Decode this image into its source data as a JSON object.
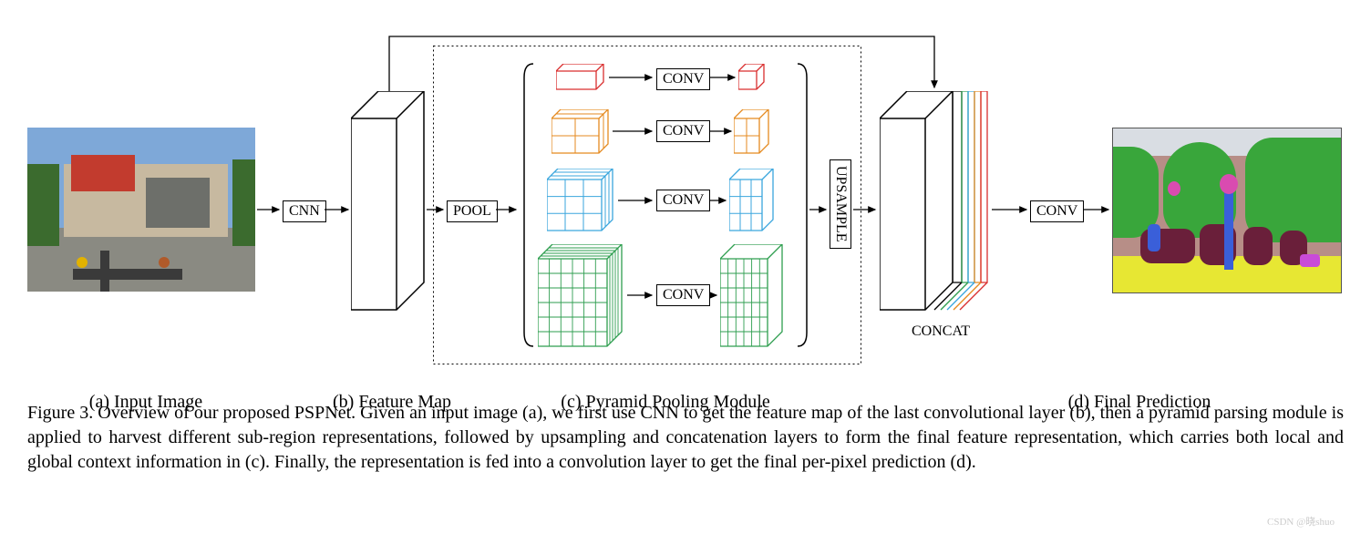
{
  "ops": {
    "cnn": "CNN",
    "pool": "POOL",
    "conv1": "CONV",
    "conv2": "CONV",
    "conv3": "CONV",
    "conv4": "CONV",
    "upsample": "UPSAMPLE",
    "conv_out": "CONV",
    "concat": "CONCAT"
  },
  "sublabels": {
    "a": "(a) Input Image",
    "b": "(b) Feature Map",
    "c": "(c) Pyramid Pooling Module",
    "d": "(d) Final Prediction"
  },
  "caption": "Figure 3. Overview of our proposed PSPNet. Given an input image (a), we first use CNN to get the feature map of the last convolutional layer (b), then a pyramid parsing module is applied to harvest different sub-region representations, followed by upsampling and concatenation layers to form the final feature representation, which carries both local and global context information in (c). Finally, the representation is fed into a convolution layer to get the final per-pixel prediction (d).",
  "watermark": "CSDN @晓shuo",
  "pyramid": {
    "levels": [
      {
        "grid": 1,
        "color": "#d92e2e"
      },
      {
        "grid": 2,
        "color": "#e58a1f"
      },
      {
        "grid": 3,
        "color": "#3aa6dd"
      },
      {
        "grid": 6,
        "color": "#2e9e4f"
      }
    ]
  }
}
